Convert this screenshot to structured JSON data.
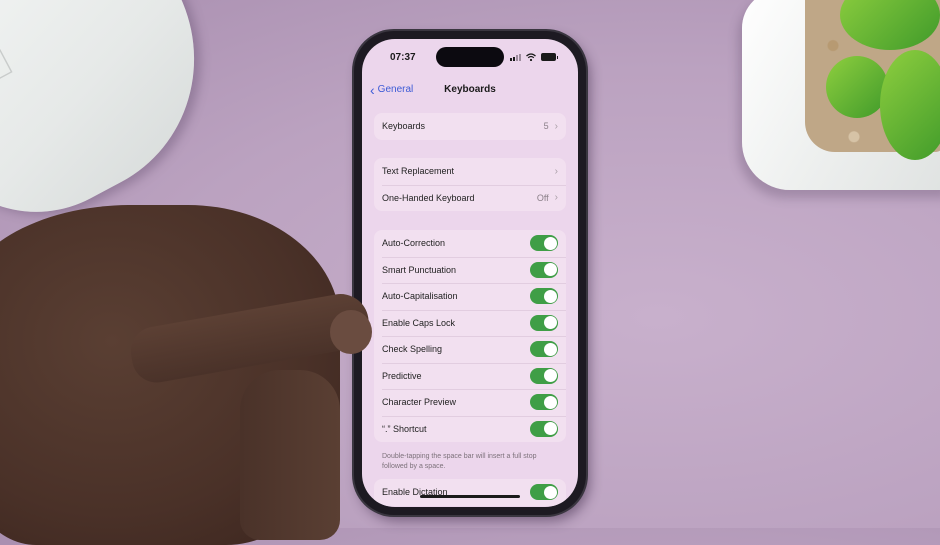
{
  "status_bar": {
    "time": "07:37",
    "icons": [
      "signal-icon",
      "wifi-icon",
      "battery-icon"
    ]
  },
  "nav": {
    "back_label": "General",
    "title": "Keyboards"
  },
  "groups": [
    {
      "rows": [
        {
          "label": "Keyboards",
          "value": "5",
          "type": "link"
        }
      ]
    },
    {
      "rows": [
        {
          "label": "Text Replacement",
          "value": "",
          "type": "link"
        },
        {
          "label": "One-Handed Keyboard",
          "value": "Off",
          "type": "link"
        }
      ]
    },
    {
      "rows": [
        {
          "label": "Auto-Correction",
          "type": "toggle",
          "on": true
        },
        {
          "label": "Smart Punctuation",
          "type": "toggle",
          "on": true
        },
        {
          "label": "Auto-Capitalisation",
          "type": "toggle",
          "on": true
        },
        {
          "label": "Enable Caps Lock",
          "type": "toggle",
          "on": true
        },
        {
          "label": "Check Spelling",
          "type": "toggle",
          "on": true
        },
        {
          "label": "Predictive",
          "type": "toggle",
          "on": true
        },
        {
          "label": "Character Preview",
          "type": "toggle",
          "on": true
        },
        {
          "label": "“.” Shortcut",
          "type": "toggle",
          "on": true
        }
      ],
      "footer": "Double-tapping the space bar will insert a full stop followed by a space."
    },
    {
      "rows": [
        {
          "label": "Enable Dictation",
          "type": "toggle",
          "on": true
        }
      ]
    }
  ],
  "colors": {
    "accent": "#3d5bd6",
    "toggle_on": "#3f9e46",
    "screen_bg": "#ecd6ec",
    "desk": "#bba2c0"
  }
}
